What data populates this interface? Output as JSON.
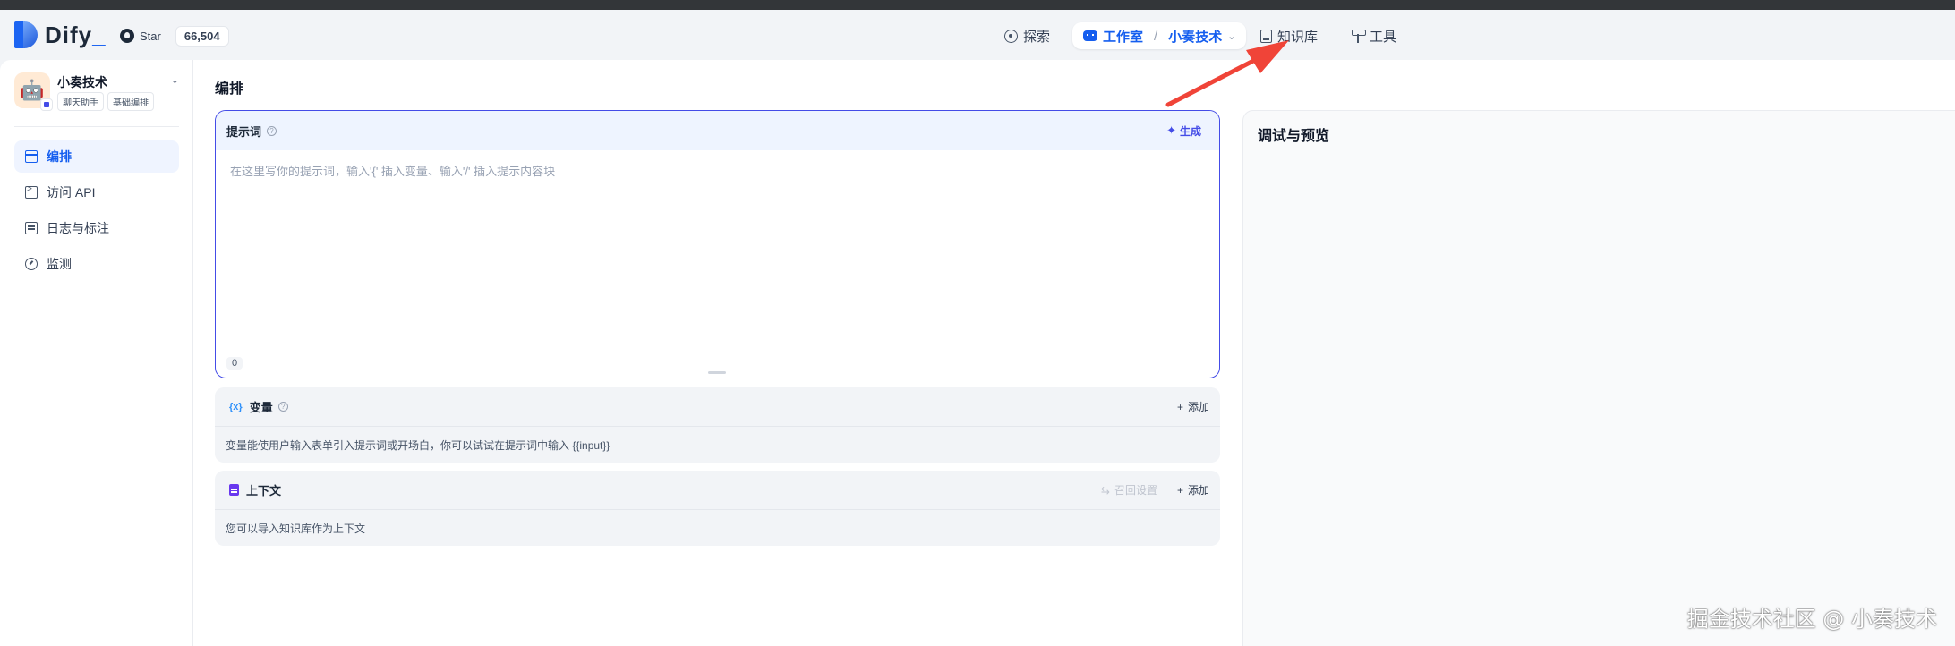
{
  "header": {
    "logo_text": "Dify",
    "github_label": "Star",
    "github_stars": "66,504",
    "nav": {
      "explore": "探索",
      "studio": "工作室",
      "workspace": "小奏技术",
      "knowledge": "知识库",
      "tools": "工具"
    }
  },
  "sidebar": {
    "app_name": "小奏技术",
    "app_avatar": "🤖",
    "tags": [
      "聊天助手",
      "基础编排"
    ],
    "items": [
      {
        "label": "编排",
        "icon": "layout-icon"
      },
      {
        "label": "访问 API",
        "icon": "terminal-icon"
      },
      {
        "label": "日志与标注",
        "icon": "file-list-icon"
      },
      {
        "label": "监测",
        "icon": "gauge-icon"
      }
    ]
  },
  "main": {
    "title": "编排",
    "prompt": {
      "title": "提示词",
      "generate_label": "生成",
      "placeholder": "在这里写你的提示词，输入'{' 插入变量、输入'/' 插入提示内容块",
      "char_count": "0"
    },
    "variables": {
      "title": "变量",
      "add_label": "添加",
      "description": "变量能使用户输入表单引入提示词或开场白，你可以试试在提示词中输入 {{input}}"
    },
    "context": {
      "title": "上下文",
      "recall_label": "召回设置",
      "add_label": "添加",
      "description": "您可以导入知识库作为上下文"
    }
  },
  "preview": {
    "title": "调试与预览"
  },
  "watermark": "掘金技术社区 @ 小奏技术",
  "colors": {
    "accent": "#155eef",
    "prompt_border": "#444ce7",
    "annotation_arrow": "#f04438"
  }
}
